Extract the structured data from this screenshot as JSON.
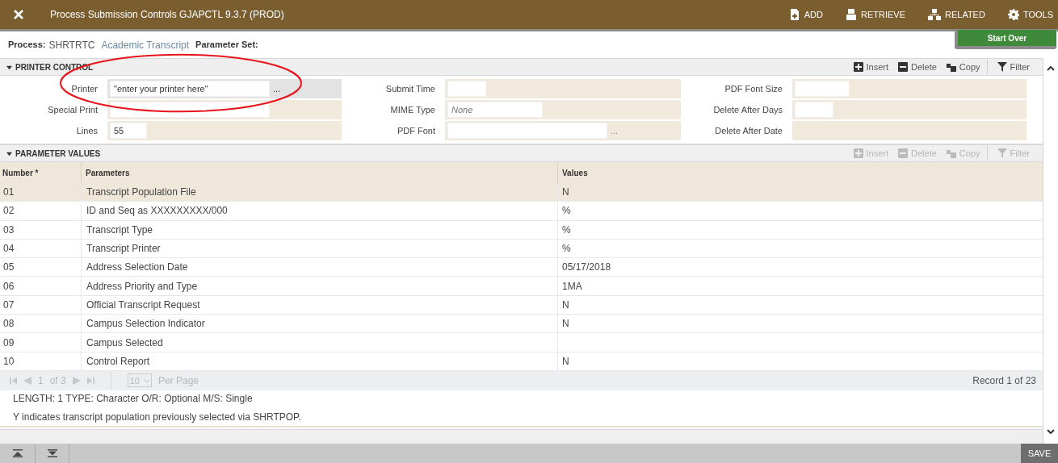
{
  "window": {
    "title": "Process Submission Controls GJAPCTL 9.3.7 (PROD)"
  },
  "toolbar": [
    {
      "kind": "add",
      "label": "ADD"
    },
    {
      "kind": "retrieve",
      "label": "RETRIEVE"
    },
    {
      "kind": "related",
      "label": "RELATED"
    },
    {
      "kind": "tools",
      "label": "TOOLS"
    }
  ],
  "process": {
    "label": "Process:",
    "code": "SHRTRTC",
    "description": "Academic Transcript",
    "parameter_set_label": "Parameter Set:"
  },
  "start_over": "Start Over",
  "printer_control": {
    "title": "PRINTER CONTROL",
    "expanded": true,
    "actions": [
      {
        "kind": "insert",
        "label": "Insert",
        "disabled": false
      },
      {
        "kind": "delete",
        "label": "Delete",
        "disabled": false
      },
      {
        "kind": "copy",
        "label": "Copy",
        "disabled": false
      },
      {
        "kind": "filter",
        "label": "Filter",
        "disabled": false
      }
    ],
    "fields": [
      {
        "kind": "input",
        "label": "Printer",
        "value": "\"enter your printer here\"",
        "lookup": "...",
        "disabled": false
      },
      {
        "kind": "input",
        "label": "Special Print"
      },
      {
        "kind": "input",
        "label": "Lines",
        "value": "55"
      },
      {
        "kind": "input",
        "label": "Submit Time"
      },
      {
        "kind": "input",
        "label": "MIME Type",
        "placeholder": "None"
      },
      {
        "kind": "input",
        "label": "PDF Font",
        "lookup": "...",
        "disabled": true
      },
      {
        "kind": "input",
        "label": "PDF Font Size"
      },
      {
        "kind": "input",
        "label": "Delete After Days"
      },
      {
        "kind": "display",
        "label": "Delete After Date"
      }
    ]
  },
  "parameter_values": {
    "title": "PARAMETER VALUES",
    "expanded": true,
    "actions": [
      {
        "kind": "insert",
        "label": "Insert",
        "disabled": true
      },
      {
        "kind": "delete",
        "label": "Delete",
        "disabled": true
      },
      {
        "kind": "copy",
        "label": "Copy",
        "disabled": true
      },
      {
        "kind": "filter",
        "label": "Filter",
        "disabled": true
      }
    ],
    "columns": [
      "Number *",
      "Parameters",
      "Values"
    ],
    "rows": [
      {
        "number": "01",
        "parameter": "Transcript Population File",
        "value": "N",
        "selected": true
      },
      {
        "number": "02",
        "parameter": "ID and Seq as XXXXXXXXX/000",
        "value": "%",
        "selected": false
      },
      {
        "number": "03",
        "parameter": "Transcript Type",
        "value": "%",
        "selected": false
      },
      {
        "number": "04",
        "parameter": "Transcript Printer",
        "value": "%",
        "selected": false
      },
      {
        "number": "05",
        "parameter": "Address Selection Date",
        "value": "05/17/2018",
        "selected": false
      },
      {
        "number": "06",
        "parameter": "Address Priority and Type",
        "value": "1MA",
        "selected": false
      },
      {
        "number": "07",
        "parameter": "Official Transcript Request",
        "value": "N",
        "selected": false
      },
      {
        "number": "08",
        "parameter": "Campus Selection Indicator",
        "value": "N",
        "selected": false
      },
      {
        "number": "09",
        "parameter": "Campus Selected",
        "selected": false
      },
      {
        "number": "10",
        "parameter": "Control Report",
        "value": "N",
        "selected": false
      }
    ],
    "pagination": {
      "page": "1",
      "of": "of 3",
      "per_page": "10",
      "per_page_label": "Per Page",
      "record": "Record 1 of 23"
    },
    "info": [
      "LENGTH: 1 TYPE: Character O/R: Optional M/S: Single",
      "Y indicates transcript population previously selected via SHRTPOP."
    ]
  },
  "save": "SAVE"
}
